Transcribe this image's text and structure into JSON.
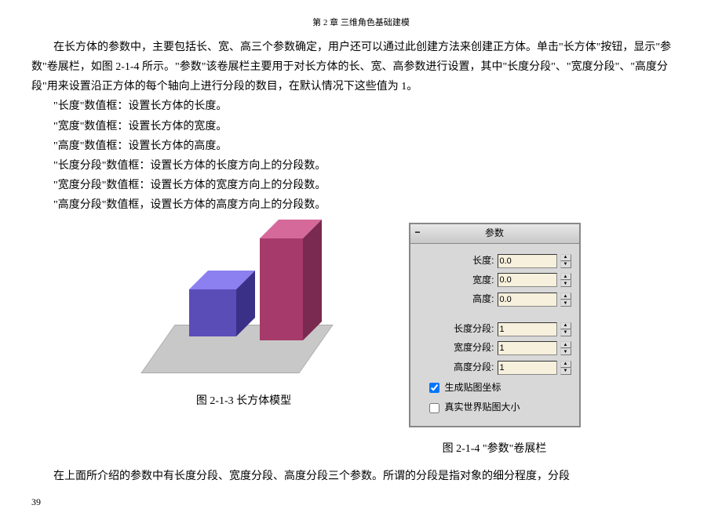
{
  "chapter_header": "第 2 章 三维角色基础建模",
  "para1": "在长方体的参数中，主要包括长、宽、高三个参数确定，用户还可以通过此创建方法来创建正方体。单击\"长方体\"按钮，显示\"参数\"卷展栏，如图 2-1-4 所示。\"参数\"该卷展栏主要用于对长方体的长、宽、高参数进行设置，其中\"长度分段\"、\"宽度分段\"、\"高度分段\"用来设置沿正方体的每个轴向上进行分段的数目，在默认情况下这些值为 1。",
  "bullets": [
    "\"长度\"数值框：设置长方体的长度。",
    "\"宽度\"数值框：设置长方体的宽度。",
    "\"高度\"数值框：设置长方体的高度。",
    "\"长度分段\"数值框：设置长方体的长度方向上的分段数。",
    "\"宽度分段\"数值框：设置长方体的宽度方向上的分段数。",
    "\"高度分段\"数值框，设置长方体的高度方向上的分段数。"
  ],
  "fig_left_caption": "图 2-1-3 长方体模型",
  "fig_right_caption": "图 2-1-4 \"参数\"卷展栏",
  "panel": {
    "title": "参数",
    "length_label": "长度:",
    "length_value": "0.0",
    "width_label": "宽度:",
    "width_value": "0.0",
    "height_label": "高度:",
    "height_value": "0.0",
    "lseg_label": "长度分段:",
    "lseg_value": "1",
    "wseg_label": "宽度分段:",
    "wseg_value": "1",
    "hseg_label": "高度分段:",
    "hseg_value": "1",
    "gen_mapping": "生成贴图坐标",
    "real_world": "真实世界贴图大小"
  },
  "para2": "在上面所介绍的参数中有长度分段、宽度分段、高度分段三个参数。所谓的分段是指对象的细分程度，分段",
  "page_num": "39"
}
